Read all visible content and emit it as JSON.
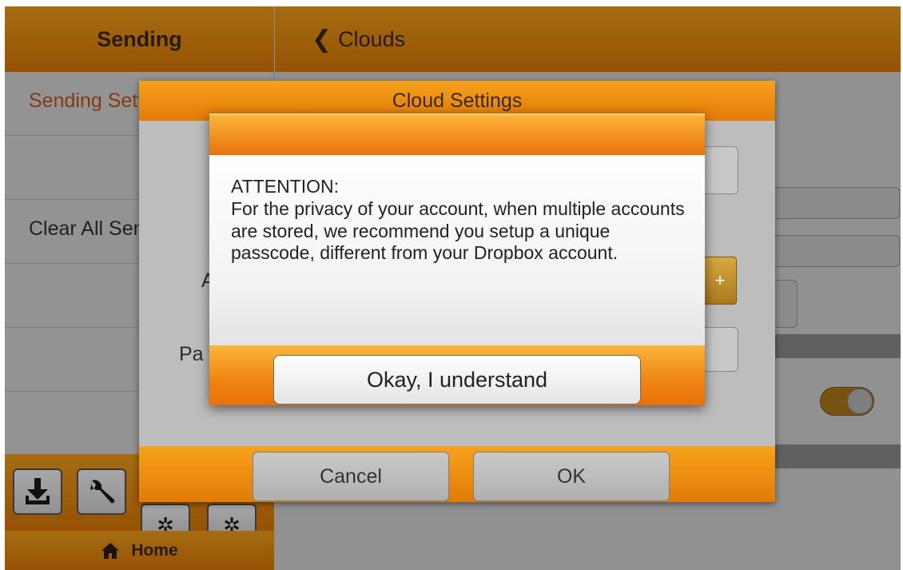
{
  "left_panel": {
    "header_title": "Sending",
    "menu_items": [
      {
        "label": "Sending Settings"
      },
      {
        "label": ""
      },
      {
        "label": "Clear All Sent"
      },
      {
        "label": ""
      },
      {
        "label": ""
      }
    ],
    "tools": [
      {
        "icon": "download-icon"
      },
      {
        "icon": "wrench-icon"
      },
      {
        "icon": "gear-icon"
      },
      {
        "icon": "gear-icon"
      }
    ],
    "home_label": "Home",
    "home_icon": "home-icon"
  },
  "right_panel": {
    "back_label": "Clouds",
    "back_icon": "chevron-left-icon",
    "toggle_on": true
  },
  "cloud_dialog": {
    "title": "Cloud Settings",
    "account_label_fragment": "A",
    "password_label_fragment": "Pa",
    "cancel_label": "Cancel",
    "ok_label": "OK"
  },
  "attention_dialog": {
    "heading": "ATTENTION:",
    "message": "For the privacy of your account, when multiple accounts are stored, we recommend you setup a unique passcode, different from your Dropbox account.",
    "confirm_label": "Okay, I understand"
  },
  "colors": {
    "accent_orange": "#f39a1a",
    "accent_orange_dark": "#e17b07",
    "selected_text": "#c25a1a"
  }
}
